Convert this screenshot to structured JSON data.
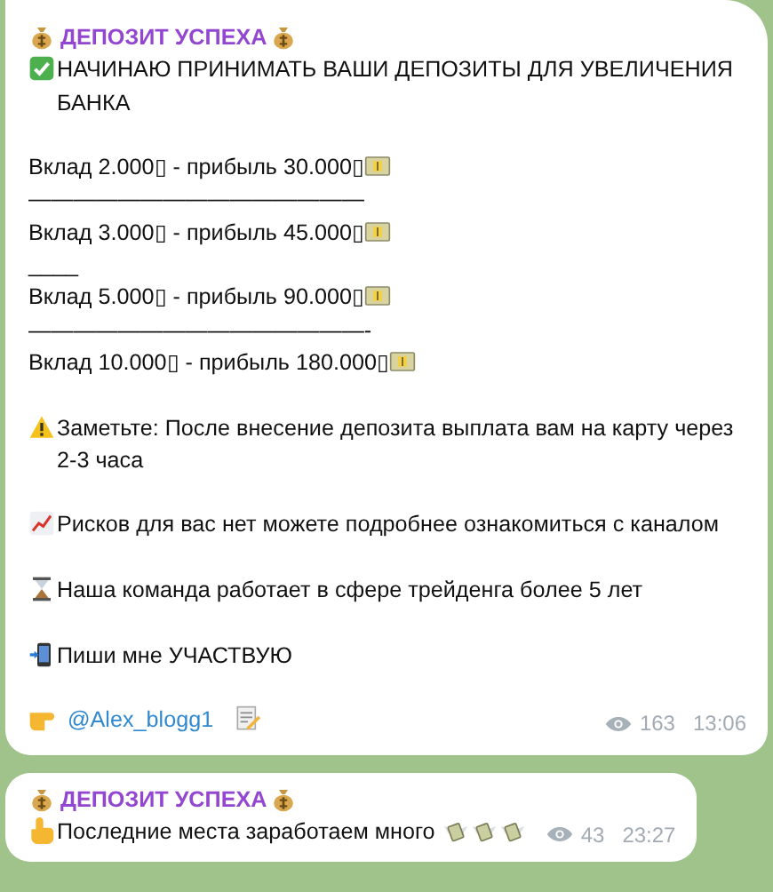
{
  "messages": [
    {
      "author": "ДЕПОЗИТ УСПЕХА",
      "lines": [
        {
          "kind": "check",
          "text": "НАЧИНАЮ ПРИНИМАТЬ ВАШИ ДЕПОЗИТЫ ДЛЯ УВЕЛИЧЕНИЯ БАНКА"
        },
        {
          "kind": "gap"
        },
        {
          "kind": "offer",
          "text": "Вклад 2.000▯ - прибыль 30.000▯"
        },
        {
          "kind": "plain",
          "text": "———————————————"
        },
        {
          "kind": "offer",
          "text": "Вклад 3.000▯ - прибыль 45.000▯"
        },
        {
          "kind": "plain",
          "text": "____"
        },
        {
          "kind": "offer",
          "text": "Вклад 5.000▯ - прибыль 90.000▯"
        },
        {
          "kind": "plain",
          "text": "———————————————-"
        },
        {
          "kind": "offer",
          "text": "Вклад 10.000▯ - прибыль 180.000▯"
        },
        {
          "kind": "gap"
        },
        {
          "kind": "warning",
          "text": "Заметьте: После внесение депозита выплата вам на карту через 2-3 часа"
        },
        {
          "kind": "gap"
        },
        {
          "kind": "chart",
          "text": "Рисков для вас нет можете подробнее ознакомиться с каналом"
        },
        {
          "kind": "gap"
        },
        {
          "kind": "hourglass",
          "text": "Наша команда работает в сфере трейденга  более 5 лет"
        },
        {
          "kind": "gap"
        },
        {
          "kind": "phone",
          "text": "Пиши мне УЧАСТВУЮ"
        },
        {
          "kind": "gap"
        },
        {
          "kind": "contact",
          "text": "@Alex_blogg1"
        }
      ],
      "views": "163",
      "time": "13:06"
    },
    {
      "author": "ДЕПОЗИТ УСПЕХА",
      "lines": [
        {
          "kind": "point",
          "text": "Последние места заработаем много"
        }
      ],
      "views": "43",
      "time": "23:27"
    }
  ]
}
